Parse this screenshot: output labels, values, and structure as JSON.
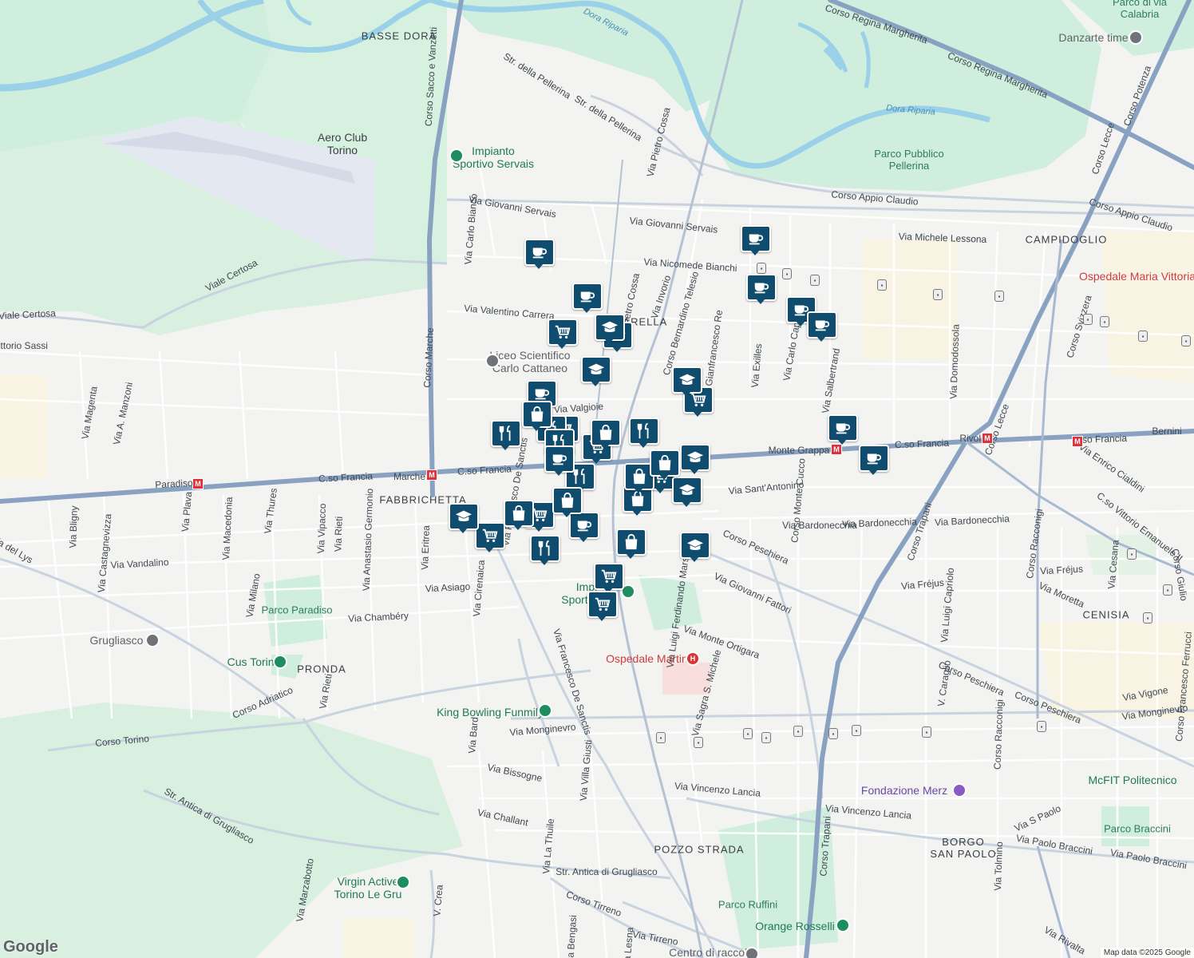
{
  "colors": {
    "background": "#f3f3f1",
    "park": "#cfeedd",
    "water": "#9ad1e8",
    "major_road": "#8aa2c2",
    "minor_road": "#ffffff",
    "marker": "#0f4c6e"
  },
  "districts": [
    {
      "id": "basse-dora",
      "text": "BASSE DORA"
    },
    {
      "id": "parella",
      "text": "PARELLA"
    },
    {
      "id": "fabbrichetta",
      "text": "FABBRICHETTA"
    },
    {
      "id": "campidoglio",
      "text": "CAMPIDOGLIO"
    },
    {
      "id": "cenisia",
      "text": "CENISIA"
    },
    {
      "id": "pronda",
      "text": "PRONDA"
    },
    {
      "id": "pozzo-strada",
      "text": "POZZO STRADA"
    },
    {
      "id": "borgo-san-paolo",
      "text": "BORGO\nSAN PAOLO"
    }
  ],
  "places": [
    {
      "id": "aero-club",
      "text": "Aero Club\nTorino",
      "style": "place"
    },
    {
      "id": "impianto-servais",
      "text": "Impianto\nSportivo Servais",
      "style": "poi"
    },
    {
      "id": "liceo",
      "text": "Liceo Scientifico\nCarlo Cattaneo",
      "style": "gray"
    },
    {
      "id": "parco-pellerina",
      "text": "Parco Pubblico\nPellerina",
      "style": "green"
    },
    {
      "id": "parco-calabria",
      "text": "Parco di via\nCalabria",
      "style": "green"
    },
    {
      "id": "danzarte",
      "text": "Danzarte time",
      "style": "gray"
    },
    {
      "id": "ospedale-vittoria",
      "text": "Ospedale Maria Vittoria",
      "style": "red"
    },
    {
      "id": "ospedale-martini",
      "text": "Ospedale Martini",
      "style": "red"
    },
    {
      "id": "parco-paradiso",
      "text": "Parco Paradiso",
      "style": "green"
    },
    {
      "id": "cus-torino",
      "text": "Cus Torino",
      "style": "poi"
    },
    {
      "id": "grugliasco",
      "text": "Grugliasco",
      "style": "gray"
    },
    {
      "id": "king-bowling",
      "text": "King Bowling Funmily",
      "style": "poi"
    },
    {
      "id": "impianto-t",
      "text": "Impi\nSportivo T",
      "style": "poi"
    },
    {
      "id": "fondazione-merz",
      "text": "Fondazione Merz",
      "style": "purple"
    },
    {
      "id": "mcfit",
      "text": "McFIT Politecnico",
      "style": "poi"
    },
    {
      "id": "parco-braccini",
      "text": "Parco Braccini",
      "style": "green"
    },
    {
      "id": "virgin-active",
      "text": "Virgin Active\nTorino Le Gru",
      "style": "poi"
    },
    {
      "id": "parco-ruffini",
      "text": "Parco Ruffini",
      "style": "green"
    },
    {
      "id": "orange-rosselli",
      "text": "Orange Rosselli",
      "style": "poi"
    },
    {
      "id": "centro-raccolta",
      "text": "Centro di raccolta",
      "style": "gray"
    }
  ],
  "streets": [
    "Corso Sacco e Vanzetti",
    "Str. della Pellerina",
    "Str. della Pellerina",
    "Via Pietro Cossa",
    "Via Pietro Cossa",
    "Corso Regina Margherita",
    "Corso Regina Margherita",
    "Corso Appio Claudio",
    "Corso Appio Claudio",
    "Via Giovanni Servais",
    "Via Giovanni Servais",
    "Via Carlo Bianco",
    "Via Nicomede Bianchi",
    "Via Michele Lessona",
    "Via Valentino Carrera",
    "Corso Marche",
    "Viale Certosa",
    "Viale Certosa",
    "Via Invorio",
    "Corso Bernardino Telesio",
    "Via Gianfrancesco Re",
    "Via Exilles",
    "Via Carlo Capelli",
    "Via Salbertrand",
    "Via Domodossola",
    "Corso Lecce",
    "Corso Lecce",
    "Corso Potenza",
    "Corso Svizzera",
    "Vittorio Sassi",
    "Via Magenta",
    "Via A. Manzoni",
    "Via Valgioie",
    "C.so Francia",
    "Marche",
    "C.so Francia",
    "Paradiso",
    "Monte Grappa",
    "C.so Francia",
    "Rivoli",
    "C.so Francia",
    "Bernini",
    "Via Enrico Cialdini",
    "C.so Vittorio Emanuele II",
    "Via Sant'Antonino",
    "Via Bardonecchia",
    "Via Bardonecchia",
    "Via Bardonecchia",
    "Corso Monte Cucco",
    "Corso Trapani",
    "Corso Trapani",
    "Via Bligny",
    "Via Castagnevizza",
    "Via Plava",
    "Via Macedonia",
    "Via Thures",
    "Via Vipacco",
    "Via Rieti",
    "Via Anastasio Germonio",
    "Via Eritrea",
    "Via Francesco De Sanctis",
    "Via Vandalino",
    "Via Asiago",
    "Via Cirenaica",
    "Via Chambéry",
    "Via Milano",
    "Corso Peschiera",
    "Corso Peschiera",
    "Corso Peschiera",
    "Via Giovanni Fattori",
    "Via Luigi Ferdinando Marsigli",
    "Via Monte Ortigara",
    "Via Sagra S. Michele",
    "Via Fréjus",
    "Via Fréjus",
    "Via Luigi Capriolo",
    "V. Caraglio",
    "Corso Racconigi",
    "Corso Racconigi",
    "Via Moretta",
    "Via Cesana",
    "Via Vigone",
    "Via Monginevro",
    "Via Monginevro",
    "Corso Francesco Ferrucci",
    "Corso Adriatico",
    "Corso Torino",
    "Via Rieti",
    "Via Bard",
    "Via Francesco De Sanctis",
    "Via Bissogne",
    "Via Challant",
    "Via La Thuile",
    "Via Villa Giusti",
    "Via Vincenzo Lancia",
    "Via Vincenzo Lancia",
    "Str. Antica di Grugliasco",
    "Str. Antica di Grugliasco",
    "Via Marzabotto",
    "V. Crea",
    "Corso Tirreno",
    "Via Tirreno",
    "Via Bengasi",
    "Via Lesna",
    "Via S Paolo",
    "Via Paolo Braccini",
    "Via Paolo Braccini",
    "Via Tolmino",
    "Via Rivalta",
    "Dora Riparia",
    "Dora Riparia",
    "Via del Lys",
    "Corso Giulio"
  ],
  "markers": [
    {
      "icon": "cafe-icon"
    },
    {
      "icon": "cafe-icon"
    },
    {
      "icon": "cafe-icon"
    },
    {
      "icon": "cafe-icon"
    },
    {
      "icon": "cafe-icon"
    },
    {
      "icon": "cafe-icon"
    },
    {
      "icon": "cafe-icon"
    },
    {
      "icon": "cafe-icon"
    },
    {
      "icon": "cafe-icon"
    },
    {
      "icon": "cafe-icon"
    },
    {
      "icon": "cart-icon"
    },
    {
      "icon": "cart-icon"
    },
    {
      "icon": "cart-icon"
    },
    {
      "icon": "cart-icon"
    },
    {
      "icon": "cart-icon"
    },
    {
      "icon": "cart-icon"
    },
    {
      "icon": "cart-icon"
    },
    {
      "icon": "cart-icon"
    },
    {
      "icon": "cart-icon"
    },
    {
      "icon": "school-icon"
    },
    {
      "icon": "school-icon"
    },
    {
      "icon": "school-icon"
    },
    {
      "icon": "school-icon"
    },
    {
      "icon": "school-icon"
    },
    {
      "icon": "school-icon"
    },
    {
      "icon": "school-icon"
    },
    {
      "icon": "school-icon"
    },
    {
      "icon": "restaurant-icon"
    },
    {
      "icon": "restaurant-icon"
    },
    {
      "icon": "restaurant-icon"
    },
    {
      "icon": "restaurant-icon"
    },
    {
      "icon": "restaurant-icon"
    },
    {
      "icon": "restaurant-icon"
    },
    {
      "icon": "shopping-bag-icon"
    },
    {
      "icon": "shopping-bag-icon"
    },
    {
      "icon": "shopping-bag-icon"
    },
    {
      "icon": "shopping-bag-icon"
    },
    {
      "icon": "shopping-bag-icon"
    },
    {
      "icon": "shopping-bag-icon"
    },
    {
      "icon": "shopping-bag-icon"
    },
    {
      "icon": "shopping-bag-icon"
    },
    {
      "icon": "cafe-icon"
    }
  ],
  "metro": [
    "Paradiso",
    "Marche",
    "Monte Grappa",
    "Rivoli",
    "Bernini"
  ],
  "google_logo": "Google",
  "attribution": "Map data ©2025 Google"
}
